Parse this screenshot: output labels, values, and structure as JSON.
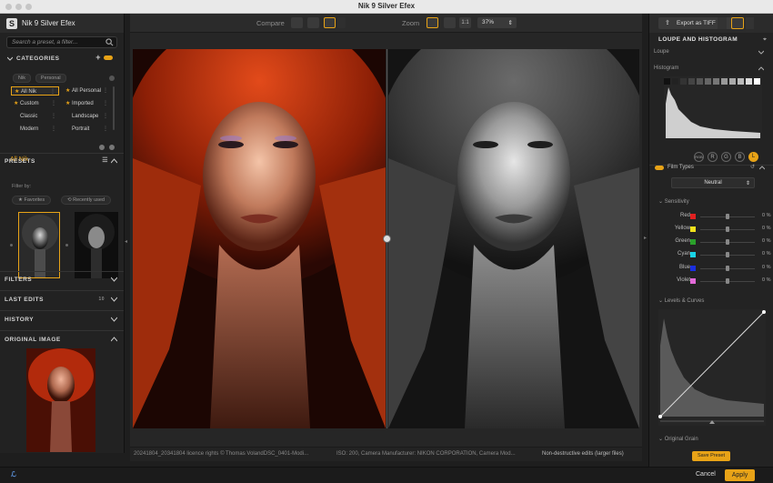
{
  "window": {
    "title": "Nik 9 Silver Efex"
  },
  "left": {
    "app_title": "Nik 9 Silver Efex",
    "search_placeholder": "Search a preset, a filter...",
    "categories_title": "CATEGORIES",
    "category_tags": [
      "Nik",
      "Personal"
    ],
    "categories": [
      {
        "label": "All Nik",
        "selected": true,
        "starred": true
      },
      {
        "label": "All Personal",
        "selected": false,
        "starred": true
      },
      {
        "label": "Custom",
        "selected": false,
        "starred": true
      },
      {
        "label": "Imported",
        "selected": false,
        "starred": true
      },
      {
        "label": "Classic",
        "selected": false,
        "starred": false
      },
      {
        "label": "Landscape",
        "selected": false,
        "starred": false
      },
      {
        "label": "Modern",
        "selected": false,
        "starred": false
      },
      {
        "label": "Portrait",
        "selected": false,
        "starred": false
      }
    ],
    "current_category": "All Nik",
    "presets_title": "PRESETS",
    "filter_by": "Filter by:",
    "favorites": "Favorites",
    "recently_used": "Recently used",
    "filters_title": "FILTERS",
    "last_edits_title": "LAST EDITS",
    "last_edits_count": "10",
    "history_title": "HISTORY",
    "original_title": "ORIGINAL IMAGE"
  },
  "toolbar": {
    "compare_label": "Compare",
    "zoom_label": "Zoom",
    "zoom_one": "1:1",
    "zoom_value": "37%"
  },
  "status": {
    "file": "20241804_20341804 licence rights © Thomas VolandDSC_0401-Modi...",
    "meta": "ISO: 200, Camera Manufacturer: NIKON CORPORATION, Camera Mod...",
    "mode": "Non-destructive edits (larger files)"
  },
  "right": {
    "export_label": "Export as TIFF",
    "panel_title": "LOUPE AND HISTOGRAM",
    "loupe": "Loupe",
    "histogram": "Histogram",
    "channels": [
      "RGB",
      "R",
      "G",
      "B",
      "L"
    ],
    "film_types": "Film Types",
    "film_value": "Neutral",
    "sensitivity": "Sensitivity",
    "sensitivity_rows": [
      {
        "label": "Red",
        "color": "#e02020",
        "value": "0 %"
      },
      {
        "label": "Yellow",
        "color": "#f2e21c",
        "value": "0 %"
      },
      {
        "label": "Green",
        "color": "#2aa12a",
        "value": "0 %"
      },
      {
        "label": "Cyan",
        "color": "#19d3e6",
        "value": "0 %"
      },
      {
        "label": "Blue",
        "color": "#1a2fe0",
        "value": "0 %"
      },
      {
        "label": "Violet",
        "color": "#e26ad8",
        "value": "0 %"
      }
    ],
    "levels_curves": "Levels & Curves",
    "original_grain": "Original Grain",
    "save_preset": "Save Preset"
  },
  "bottom": {
    "cancel": "Cancel",
    "apply": "Apply"
  },
  "colors": {
    "accent": "#e8a317"
  }
}
